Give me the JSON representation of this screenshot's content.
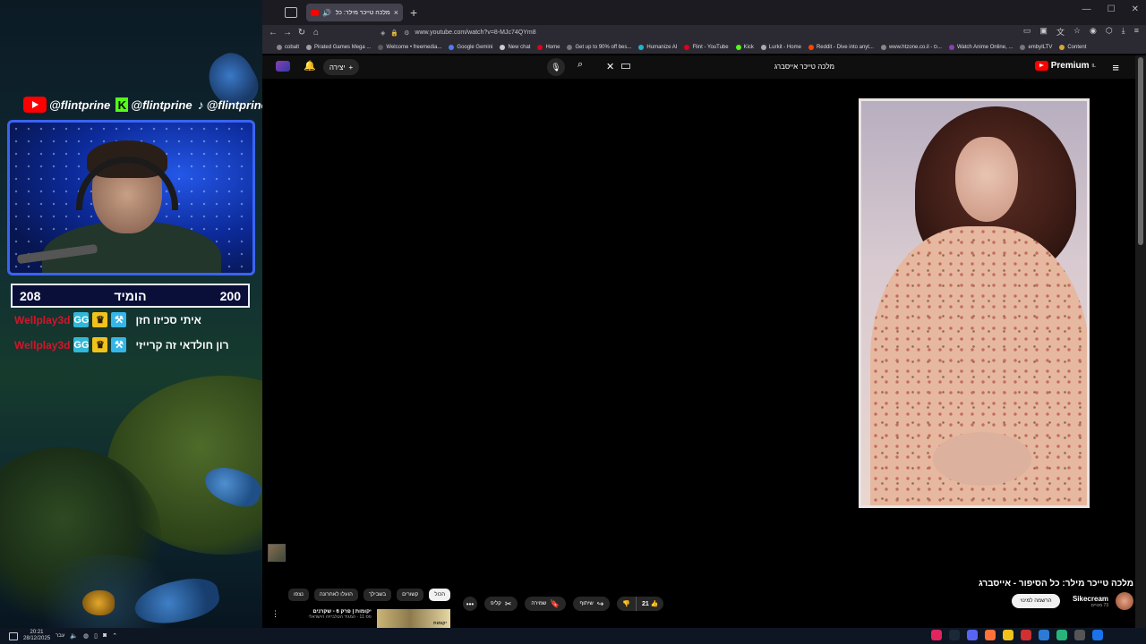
{
  "overlay": {
    "socials": [
      {
        "platform_icon": "youtube-icon",
        "handle": "@flintprine"
      },
      {
        "platform_icon": "kick-icon",
        "handle": "@flintprine"
      },
      {
        "platform_icon": "tiktok-icon",
        "handle": "@flintprine"
      }
    ],
    "scoreboard": {
      "left_score": "208",
      "label": "הומיד",
      "right_score": "200"
    },
    "matches": [
      {
        "team": "Wellplay3d",
        "players": "איתי סכיזו חזן"
      },
      {
        "team": "Wellplay3d",
        "players": "רון חולדאי זה קרייזי"
      }
    ]
  },
  "browser": {
    "tab": {
      "title": "מלכה טייכר מילר: כל הסיפ",
      "close": "×"
    },
    "new_tab": "+",
    "window_controls": [
      "—",
      "☐",
      "✕"
    ],
    "url": "www.youtube.com/watch?v=8-MJc74QYm8",
    "bookmarks": [
      {
        "label": "cobalt",
        "color": "#888888"
      },
      {
        "label": "Pirated Games Mega ...",
        "color": "#9aa0a6"
      },
      {
        "label": "Welcome • freemedia...",
        "color": "#5a5a5a"
      },
      {
        "label": "Google Gemini",
        "color": "#4f7cf0"
      },
      {
        "label": "New chat",
        "color": "#cccccc"
      },
      {
        "label": "Home",
        "color": "#e0001b"
      },
      {
        "label": "Get up to 90% off bes...",
        "color": "#777777"
      },
      {
        "label": "Humanize AI",
        "color": "#22b3c9"
      },
      {
        "label": "Flint - YouTube",
        "color": "#e0001b"
      },
      {
        "label": "Kick",
        "color": "#53fc18"
      },
      {
        "label": "Lurkit - Home",
        "color": "#aaaaaa"
      },
      {
        "label": "Reddit - Dive into anyt...",
        "color": "#ff4500"
      },
      {
        "label": "www.htzone.co.il - ס...",
        "color": "#888888"
      },
      {
        "label": "Watch Anime Online, ...",
        "color": "#8a3fb3"
      },
      {
        "label": "embyILTV",
        "color": "#777777"
      },
      {
        "label": "Content",
        "color": "#d6a43a"
      }
    ]
  },
  "youtube": {
    "brand": "Premium",
    "brand_sup": "IL",
    "create_label": "יצירה",
    "search_query": "מלכה טייכר אייסברג",
    "video_title": "מלכה טייכר מילר: כל הסיפור - אייסברג",
    "channel": {
      "name": "Sikecream",
      "subs": "73 מנויים",
      "subscribe_label": "הרשמה למינוי"
    },
    "actions": {
      "likes": "21",
      "share": "שיתוף",
      "save": "שמירה",
      "clip": "קליפ"
    },
    "chips": [
      "הכול",
      "קשורים",
      "בשבילך",
      "הועלו לאחרונה",
      "נצפו"
    ],
    "chip_active_index": 0,
    "recommendation": {
      "title": "יקומות | פרק 6 - שקרנים",
      "subtitle": "פס 11 · המגיד הטלביזיה הישראלי",
      "thumb_label": "יקומות"
    }
  },
  "taskbar": {
    "time": "20:21",
    "date": "28/12/2025",
    "lang": "עבר"
  },
  "colors": {
    "youtube_red": "#ff0000",
    "score_border": "#3a64f0",
    "team_red": "#d0162c"
  }
}
